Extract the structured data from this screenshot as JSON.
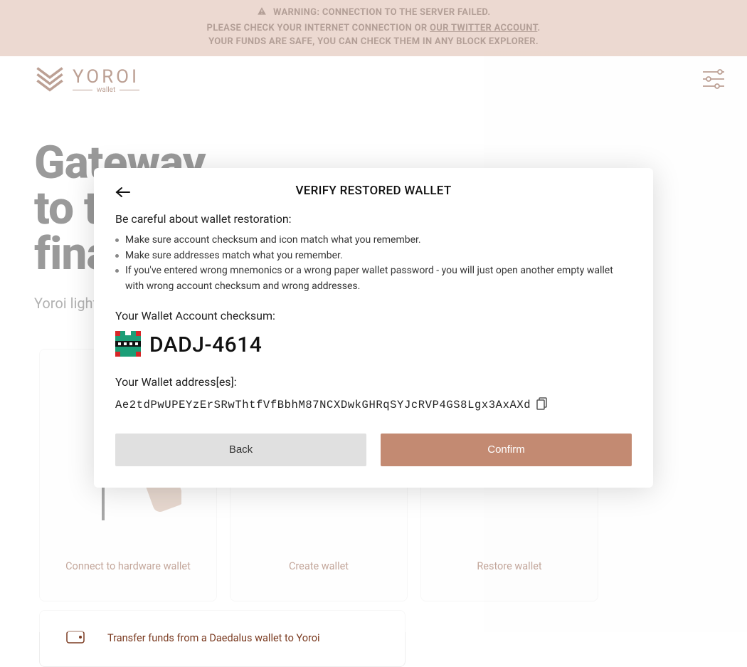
{
  "banner": {
    "line1_pre": "WARNING: CONNECTION TO THE SERVER FAILED.",
    "line2_pre": "PLEASE CHECK YOUR INTERNET CONNECTION OR ",
    "line2_link": "OUR TWITTER ACCOUNT",
    "line2_post": ".",
    "line3": "YOUR FUNDS ARE SAFE, YOU CAN CHECK THEM IN ANY BLOCK EXPLORER."
  },
  "logo": {
    "name": "YOROI",
    "sub": "wallet"
  },
  "hero": {
    "line1": "Gateway",
    "line2": "to the",
    "line3": "financial world",
    "subtitle": "Yoroi light wallet for Cardano assets"
  },
  "cards": [
    {
      "label": "Connect to hardware wallet"
    },
    {
      "label": "Create wallet"
    },
    {
      "label": "Restore wallet"
    }
  ],
  "transfer": {
    "label": "Transfer funds from a Daedalus wallet to Yoroi"
  },
  "modal": {
    "title": "VERIFY RESTORED WALLET",
    "subtitle": "Be careful about wallet restoration:",
    "bullets": [
      "Make sure account checksum and icon match what you remember.",
      "Make sure addresses match what you remember.",
      "If you've entered wrong mnemonics or a wrong paper wallet password - you will just open another empty wallet with wrong account checksum and wrong addresses."
    ],
    "checksum_label": "Your Wallet Account checksum:",
    "checksum_value": "DADJ-4614",
    "address_label": "Your Wallet address[es]:",
    "address_value": "Ae2tdPwUPEYzErSRwThtfVfBbhM87NCXDwkGHRqSYJcRVP4GS8Lgx3AxAXd",
    "back_label": "Back",
    "confirm_label": "Confirm"
  }
}
